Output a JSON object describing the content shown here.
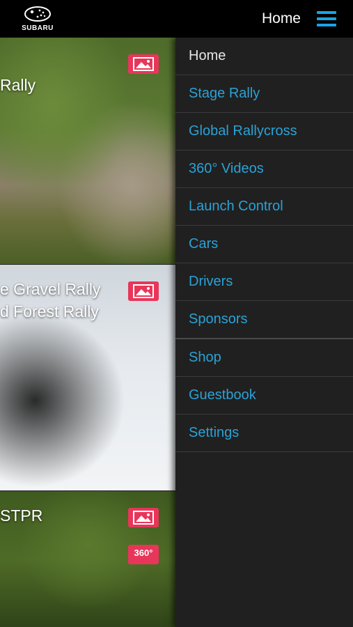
{
  "header": {
    "logo_text": "SUBARU",
    "title": "Home"
  },
  "feed": {
    "cards": [
      {
        "title_lines": [
          "Rally"
        ]
      },
      {
        "title_lines": [
          "e Gravel Rally",
          "d Forest Rally"
        ]
      },
      {
        "title_lines": [
          "STPR"
        ],
        "badge_360": "360°"
      }
    ]
  },
  "menu": {
    "items": [
      {
        "label": "Home"
      },
      {
        "label": "Stage Rally"
      },
      {
        "label": "Global Rallycross"
      },
      {
        "label": "360° Videos"
      },
      {
        "label": "Launch Control"
      },
      {
        "label": "Cars"
      },
      {
        "label": "Drivers"
      },
      {
        "label": "Sponsors"
      },
      {
        "label": "Shop"
      },
      {
        "label": "Guestbook"
      },
      {
        "label": "Settings"
      }
    ]
  },
  "colors": {
    "accent": "#1aa3e8",
    "badge": "#e8365a",
    "menu_bg": "#202020"
  }
}
